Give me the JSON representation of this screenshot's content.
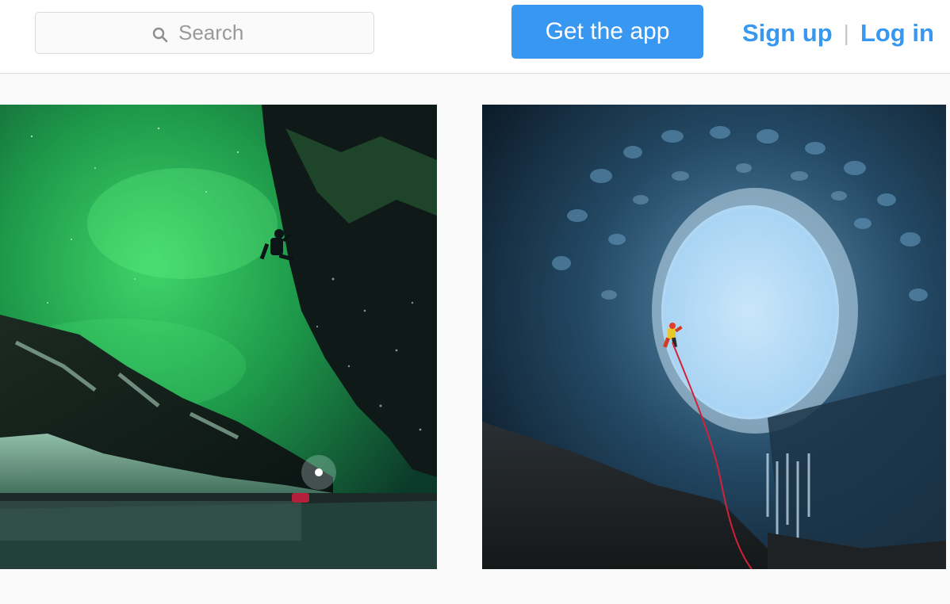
{
  "header": {
    "search": {
      "placeholder": "Search",
      "icon": "search-icon"
    },
    "get_app_label": "Get the app",
    "signup_label": "Sign up",
    "separator": "|",
    "login_label": "Log in"
  },
  "feed": {
    "photos": [
      {
        "subject": "ice climber under aurora"
      },
      {
        "subject": "ice cave climber"
      }
    ]
  },
  "colors": {
    "accent": "#3897f0",
    "border": "#dbdbdb",
    "background": "#fafafa"
  }
}
